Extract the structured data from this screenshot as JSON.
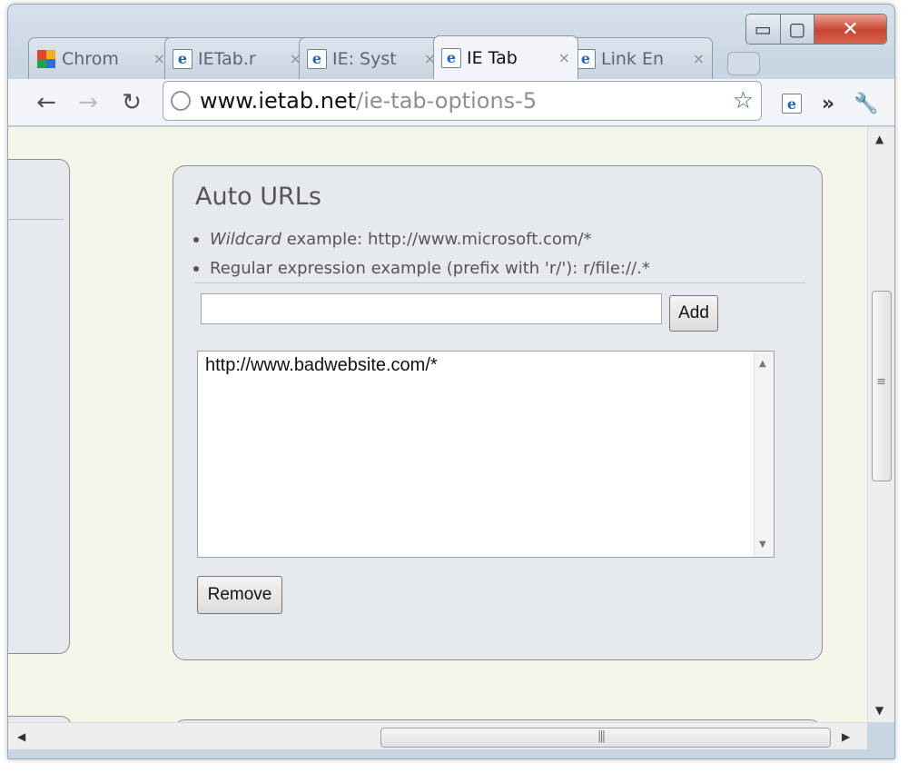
{
  "window": {
    "min_glyph": "▭",
    "max_glyph": "▢",
    "close_glyph": "✕"
  },
  "tabs": [
    {
      "label": "Chrom",
      "icon": "chrome-web-store-icon",
      "active": false
    },
    {
      "label": "IETab.r",
      "icon": "ie-icon",
      "active": false
    },
    {
      "label": "IE: Syst",
      "icon": "ie-icon",
      "active": false
    },
    {
      "label": "IE Tab",
      "icon": "ie-icon",
      "active": true
    },
    {
      "label": "Link En",
      "icon": "ie-icon",
      "active": false
    }
  ],
  "tab_close_glyph": "×",
  "toolbar": {
    "back": "←",
    "forward": "→",
    "reload": "↻",
    "url_host": "www.ietab.net",
    "url_path": "/ie-tab-options-5",
    "star": "☆",
    "more": "»",
    "wrench": "🔧"
  },
  "card": {
    "title": "Auto URLs",
    "bullet1_em": "Wildcard",
    "bullet1_rest": " example: http://www.microsoft.com/*",
    "bullet2": "Regular expression example (prefix with 'r/'): r/file://.*",
    "input_value": "",
    "add_label": "Add",
    "list_items": [
      "http://www.badwebsite.com/*"
    ],
    "remove_label": "Remove"
  }
}
